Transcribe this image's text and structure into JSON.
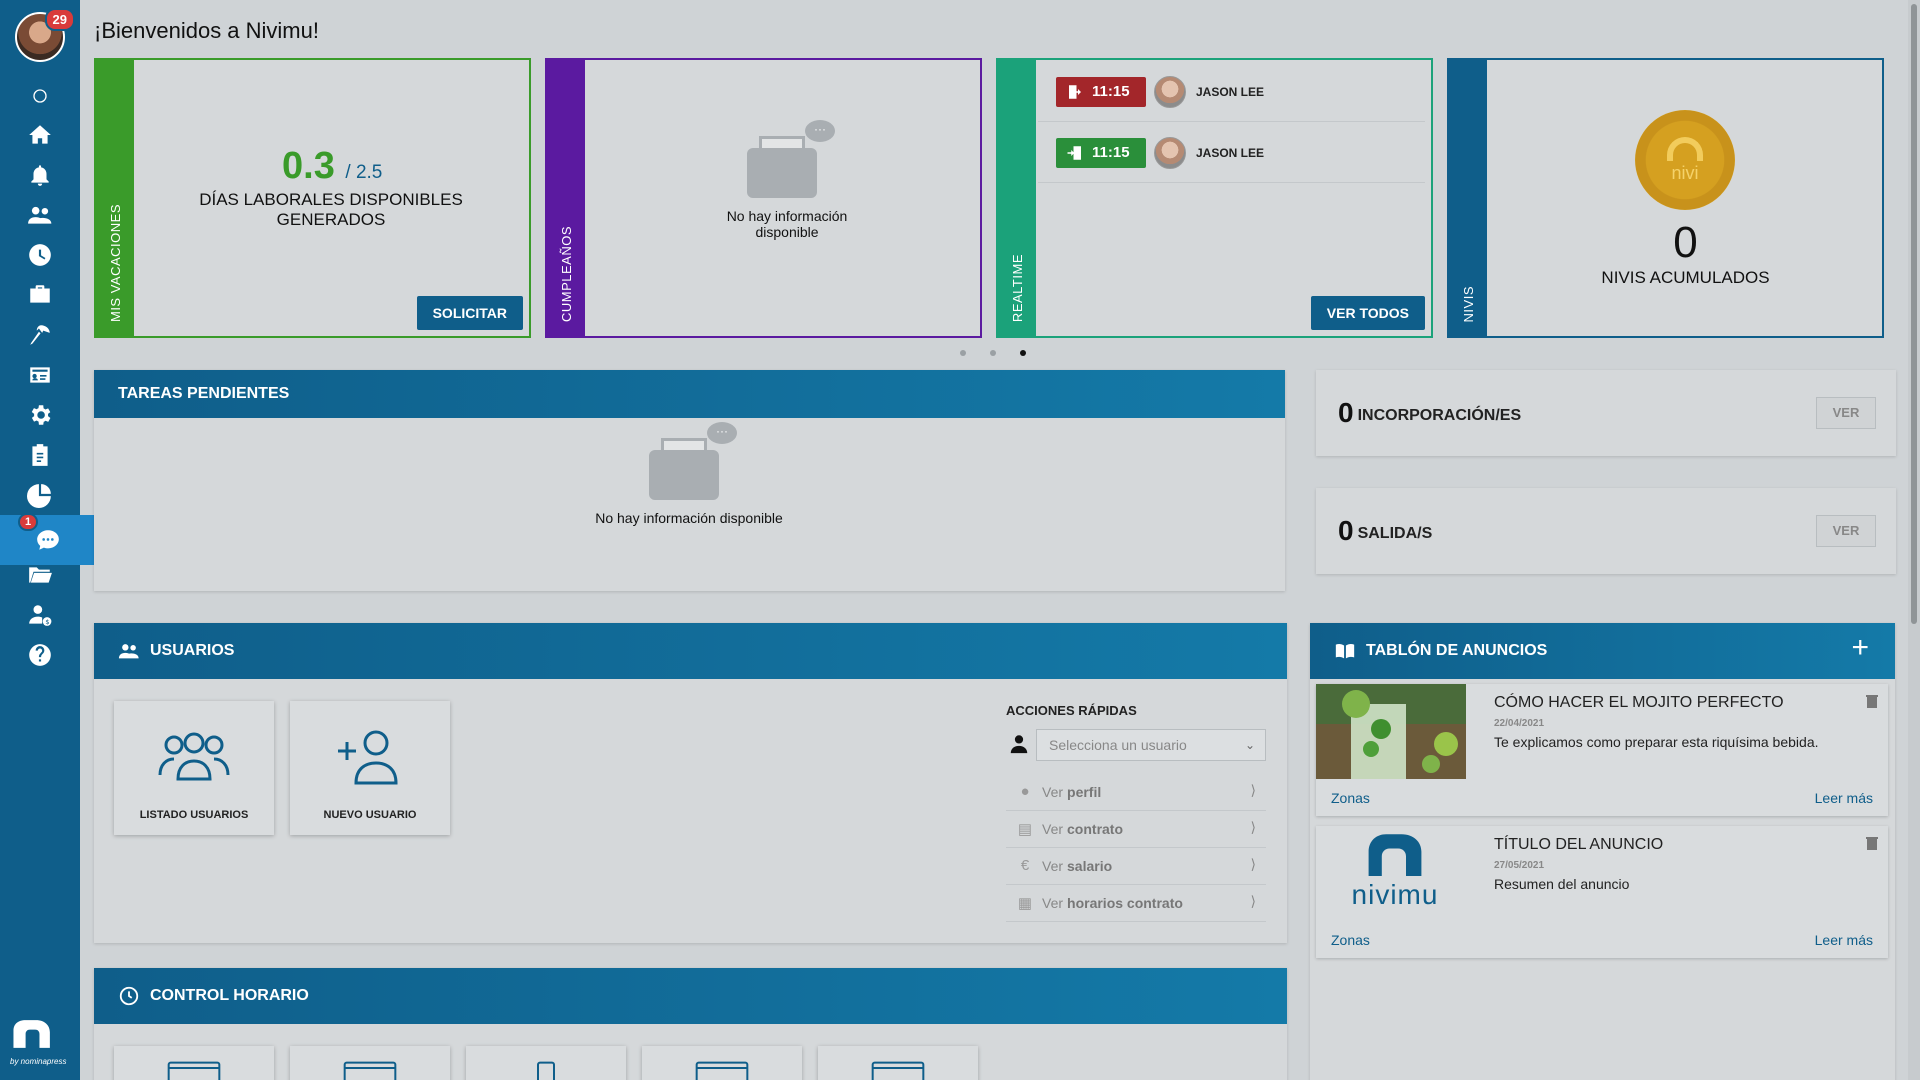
{
  "header": {
    "title": "¡Bienvenidos a Nivimu!"
  },
  "sidebar": {
    "notifications_badge": "29",
    "chat_badge": "1",
    "logo_by": "by nominapress",
    "items": [
      {
        "icon": "circle-icon"
      },
      {
        "icon": "home-icon"
      },
      {
        "icon": "bell-icon"
      },
      {
        "icon": "users-icon"
      },
      {
        "icon": "clock-icon"
      },
      {
        "icon": "briefcase-icon"
      },
      {
        "icon": "beach-umbrella-icon"
      },
      {
        "icon": "id-card-icon"
      },
      {
        "icon": "gear-icon"
      },
      {
        "icon": "clipboard-icon"
      },
      {
        "icon": "pie-chart-icon"
      },
      {
        "icon": "chat-icon"
      },
      {
        "icon": "folder-icon"
      },
      {
        "icon": "user-money-icon"
      },
      {
        "icon": "help-icon"
      }
    ]
  },
  "cards": {
    "vacaciones": {
      "label": "MIS VACACIONES",
      "value": "0.3",
      "total": "/ 2.5",
      "description": "DÍAS LABORALES DISPONIBLES GENERADOS",
      "button": "SOLICITAR",
      "color": "#3a9b2a"
    },
    "cumpleanos": {
      "label": "CUMPLEAÑOS",
      "empty_line1": "No hay información",
      "empty_line2": "disponible",
      "color": "#5b1aa0"
    },
    "realtime": {
      "label": "REALTIME",
      "button": "VER TODOS",
      "color": "#1ba27a",
      "entries": [
        {
          "time": "11:15",
          "name": "JASON LEE",
          "type": "exit",
          "color": "#a3262a"
        },
        {
          "time": "11:15",
          "name": "JASON LEE",
          "type": "entry",
          "color": "#2a8f3a"
        }
      ]
    },
    "nivis": {
      "label": "NIVIS",
      "coin_text": "nivi",
      "value": "0",
      "description": "NIVIS ACUMULADOS",
      "color": "#0f5e8a"
    }
  },
  "tareas": {
    "title": "TAREAS PENDIENTES",
    "empty": "No hay información disponible"
  },
  "usuarios": {
    "title": "USUARIOS",
    "tiles": [
      {
        "label": "LISTADO USUARIOS"
      },
      {
        "label": "NUEVO USUARIO"
      }
    ],
    "quick_actions": {
      "title": "ACCIONES RÁPIDAS",
      "select_placeholder": "Selecciona un usuario",
      "items": [
        {
          "prefix": "Ver",
          "bold": "perfil"
        },
        {
          "prefix": "Ver",
          "bold": "contrato"
        },
        {
          "prefix": "Ver",
          "bold": "salario"
        },
        {
          "prefix": "Ver",
          "bold": "horarios contrato"
        }
      ]
    }
  },
  "control_horario": {
    "title": "CONTROL HORARIO"
  },
  "stats": {
    "incorporaciones": {
      "value": "0",
      "label": "INCORPORACIÓN/ES",
      "button": "VER"
    },
    "salidas": {
      "value": "0",
      "label": "SALIDA/S",
      "button": "VER"
    }
  },
  "tablon": {
    "title": "TABLÓN DE ANUNCIOS",
    "items": [
      {
        "title": "CÓMO HACER EL MOJITO PERFECTO",
        "date": "22/04/2021",
        "text": "Te explicamos como preparar esta riquísima bebida.",
        "zones": "Zonas",
        "more": "Leer más"
      },
      {
        "title": "TÍTULO DEL ANUNCIO",
        "date": "27/05/2021",
        "text": "Resumen del anuncio",
        "zones": "Zonas",
        "more": "Leer más",
        "logo_text": "nivimu"
      }
    ]
  }
}
